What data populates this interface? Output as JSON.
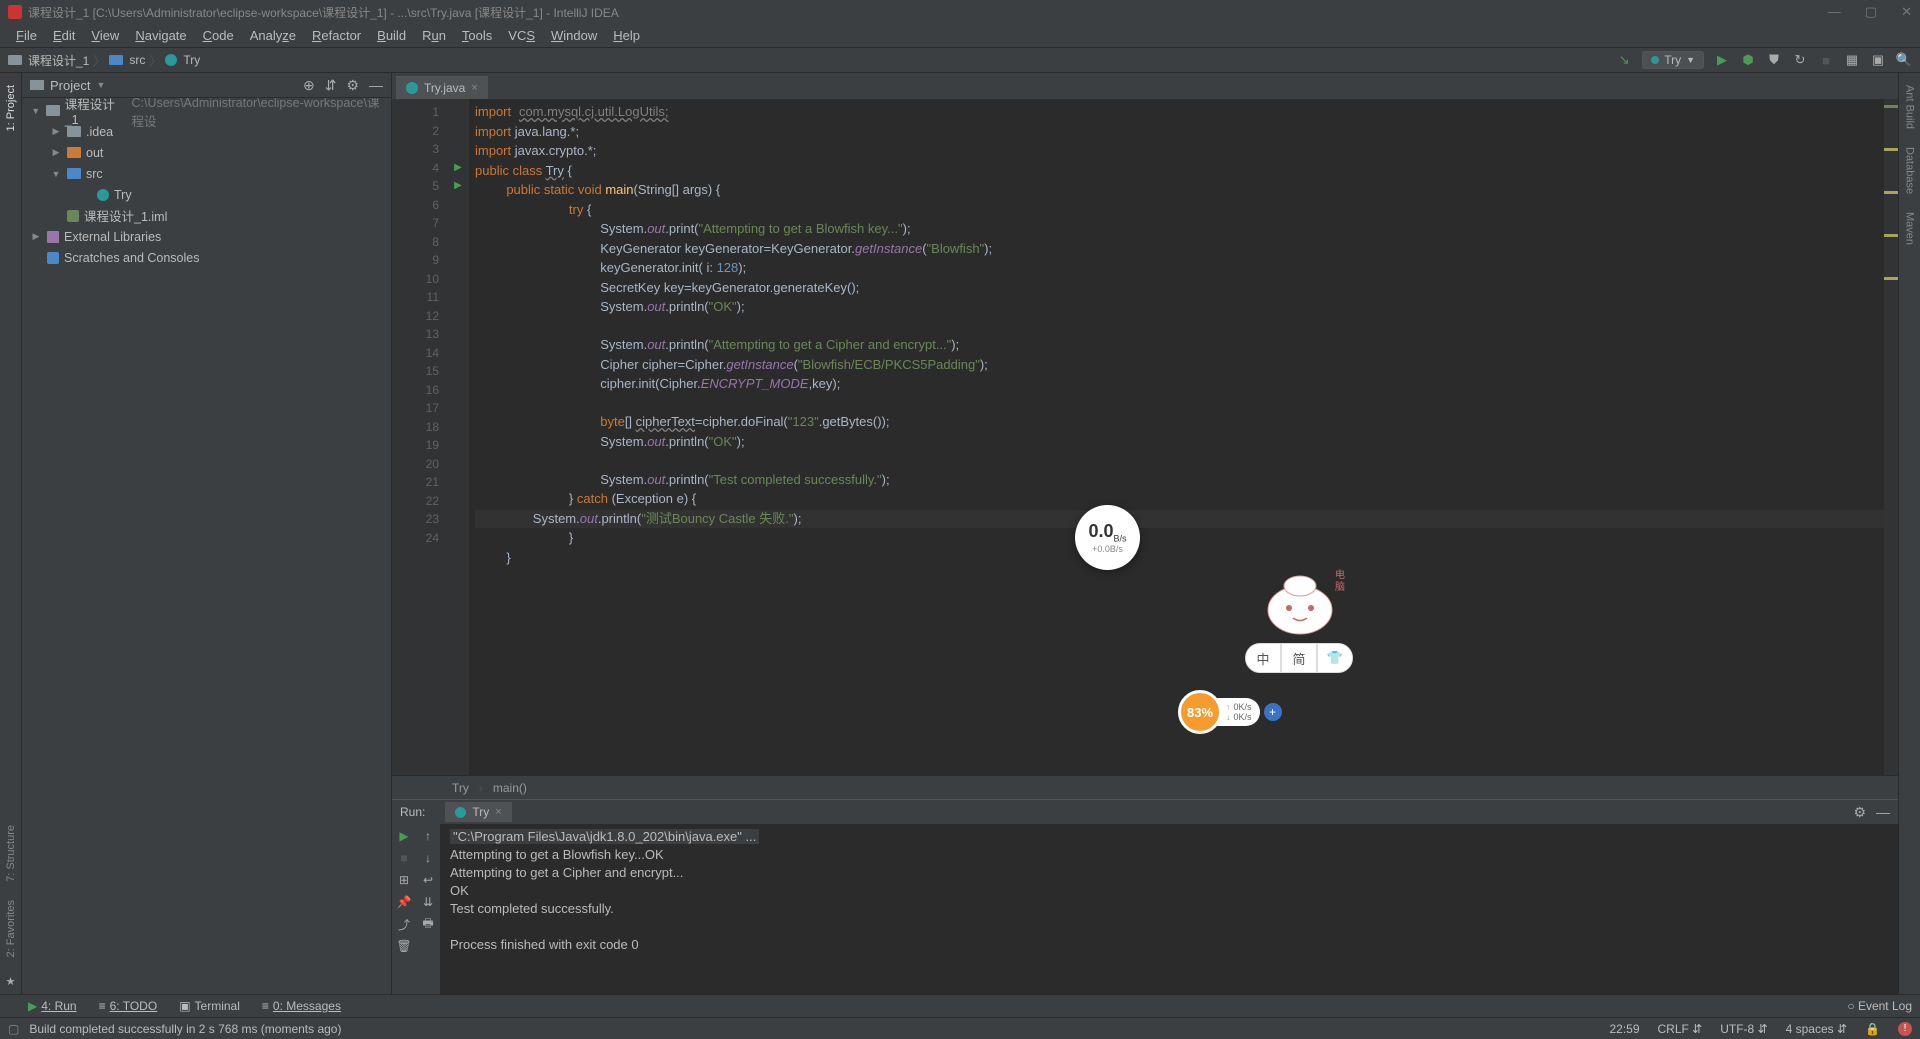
{
  "title": "课程设计_1 [C:\\Users\\Administrator\\eclipse-workspace\\课程设计_1] - ...\\src\\Try.java [课程设计_1] - IntelliJ IDEA",
  "menu": [
    "File",
    "Edit",
    "View",
    "Navigate",
    "Code",
    "Analyze",
    "Refactor",
    "Build",
    "Run",
    "Tools",
    "VCS",
    "Window",
    "Help"
  ],
  "breadcrumb": {
    "proj": "课程设计_1",
    "folder": "src",
    "file": "Try"
  },
  "run_cfg": "Try",
  "left_rail": [
    "1: Project",
    "7: Structure",
    "2: Favorites"
  ],
  "right_rail": [
    "Ant Build",
    "Database",
    "Maven"
  ],
  "project_panel": {
    "title": "Project",
    "root": {
      "name": "课程设计_1",
      "path": "C:\\Users\\Administrator\\eclipse-workspace\\课程设"
    },
    "idea": ".idea",
    "out": "out",
    "src": "src",
    "file_try": "Try",
    "iml": "课程设计_1.iml",
    "ext": "External Libraries",
    "scratch": "Scratches and Consoles"
  },
  "editor": {
    "tab": "Try.java",
    "lines": [
      "1",
      "2",
      "3",
      "4",
      "5",
      "6",
      "7",
      "8",
      "9",
      "10",
      "11",
      "12",
      "13",
      "14",
      "15",
      "16",
      "17",
      "18",
      "19",
      "20",
      "21",
      "22",
      "23",
      "24"
    ],
    "code": {
      "l1a": "import",
      "l1b": "com.mysql.cj.util.LogUtils;",
      "l2a": "import",
      "l2b": " java.lang.*;",
      "l3a": "import",
      "l3b": " javax.crypto.*;",
      "l4a": "public class ",
      "l4b": "Try",
      "l4c": " {",
      "l5a": "public static void ",
      "l5b": "main",
      "l5c": "(String[] args) {",
      "l6a": "try",
      "l6b": " {",
      "l7a": "System.",
      "l7b": "out",
      "l7c": ".print(",
      "l7d": "\"Attempting to get a Blowfish key...\"",
      "l7e": ");",
      "l8a": "KeyGenerator keyGenerator=KeyGenerator.",
      "l8b": "getInstance",
      "l8c": "(",
      "l8d": "\"Blowfish\"",
      "l8e": ");",
      "l9a": "keyGenerator.init( i: ",
      "l9b": "128",
      "l9c": ");",
      "l10": "SecretKey key=keyGenerator.generateKey();",
      "l11a": "System.",
      "l11b": "out",
      "l11c": ".println(",
      "l11d": "\"OK\"",
      "l11e": ");",
      "l13a": "System.",
      "l13b": "out",
      "l13c": ".println(",
      "l13d": "\"Attempting to get a Cipher and encrypt...\"",
      "l13e": ");",
      "l14a": "Cipher cipher=Cipher.",
      "l14b": "getInstance",
      "l14c": "(",
      "l14d": "\"Blowfish/ECB/PKCS5Padding\"",
      "l14e": ");",
      "l15a": "cipher.init(Cipher.",
      "l15b": "ENCRYPT_MODE",
      "l15c": ",key);",
      "l17a": "byte",
      "l17b": "[] ",
      "l17c": "cipherText",
      "l17d": "=cipher.doFinal(",
      "l17e": "\"123\"",
      "l17f": ".getBytes());",
      "l18a": "System.",
      "l18b": "out",
      "l18c": ".println(",
      "l18d": "\"OK\"",
      "l18e": ");",
      "l20a": "System.",
      "l20b": "out",
      "l20c": ".println(",
      "l20d": "\"Test completed successfully.\"",
      "l20e": ");",
      "l21a": "} ",
      "l21b": "catch",
      "l21c": " (Exception e) {",
      "l22a": "System.",
      "l22b": "out",
      "l22c": ".println(",
      "l22d": "\"测试Bouncy Castle 失败.\"",
      "l22e": ");",
      "l23": "}",
      "l24": "}"
    },
    "crumb1": "Try",
    "crumb2": "main()"
  },
  "run_panel": {
    "label": "Run:",
    "tab": "Try",
    "out1": "\"C:\\Program Files\\Java\\jdk1.8.0_202\\bin\\java.exe\" ...",
    "out2": "Attempting to get a Blowfish key...OK",
    "out3": "Attempting to get a Cipher and encrypt...",
    "out4": "OK",
    "out5": "Test completed successfully.",
    "out6": "Process finished with exit code 0"
  },
  "tool_strip": {
    "run": "4: Run",
    "todo": "6: TODO",
    "term": "Terminal",
    "msg": "0: Messages",
    "event": "Event Log"
  },
  "status": {
    "msg": "Build completed successfully in 2 s 768 ms (moments ago)",
    "time": "22:59",
    "crlf": "CRLF",
    "enc": "UTF-8",
    "indent": "4 spaces"
  },
  "floats": {
    "speed_big": "0.0",
    "speed_unit": "B/s",
    "speed_sub": "+0.0B/s",
    "pill1": "中",
    "pill2": "简",
    "perf_pct": "83%",
    "up": "0K/s",
    "down": "0K/s"
  }
}
